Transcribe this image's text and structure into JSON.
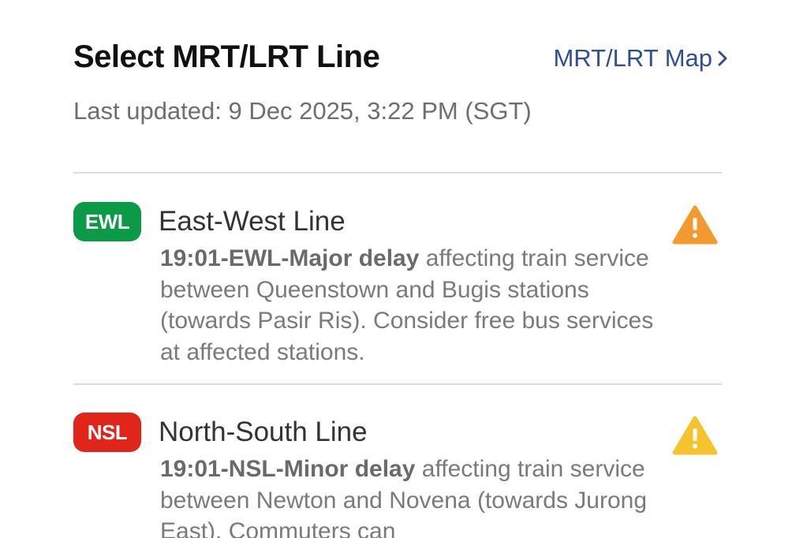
{
  "header": {
    "title": "Select MRT/LRT Line",
    "map_link_label": "MRT/LRT Map"
  },
  "last_updated": "Last updated: 9 Dec 2025, 3:22 PM (SGT)",
  "lines": [
    {
      "code": "EWL",
      "name": "East-West Line",
      "badge_color": "#0b9a45",
      "status_color": "#f29a2e",
      "status_icon": "warning-icon",
      "alert_title": "19:01-EWL-Major delay",
      "alert_body": " affecting train service between Queenstown and Bugis stations (towards Pasir Ris). Consider free bus services at affected stations."
    },
    {
      "code": "NSL",
      "name": "North-South Line",
      "badge_color": "#e1251b",
      "status_color": "#f5c32c",
      "status_icon": "warning-icon",
      "alert_title": "19:01-NSL-Minor delay",
      "alert_body": " affecting train service between Newton and Novena (towards Jurong East). Commuters can"
    }
  ]
}
